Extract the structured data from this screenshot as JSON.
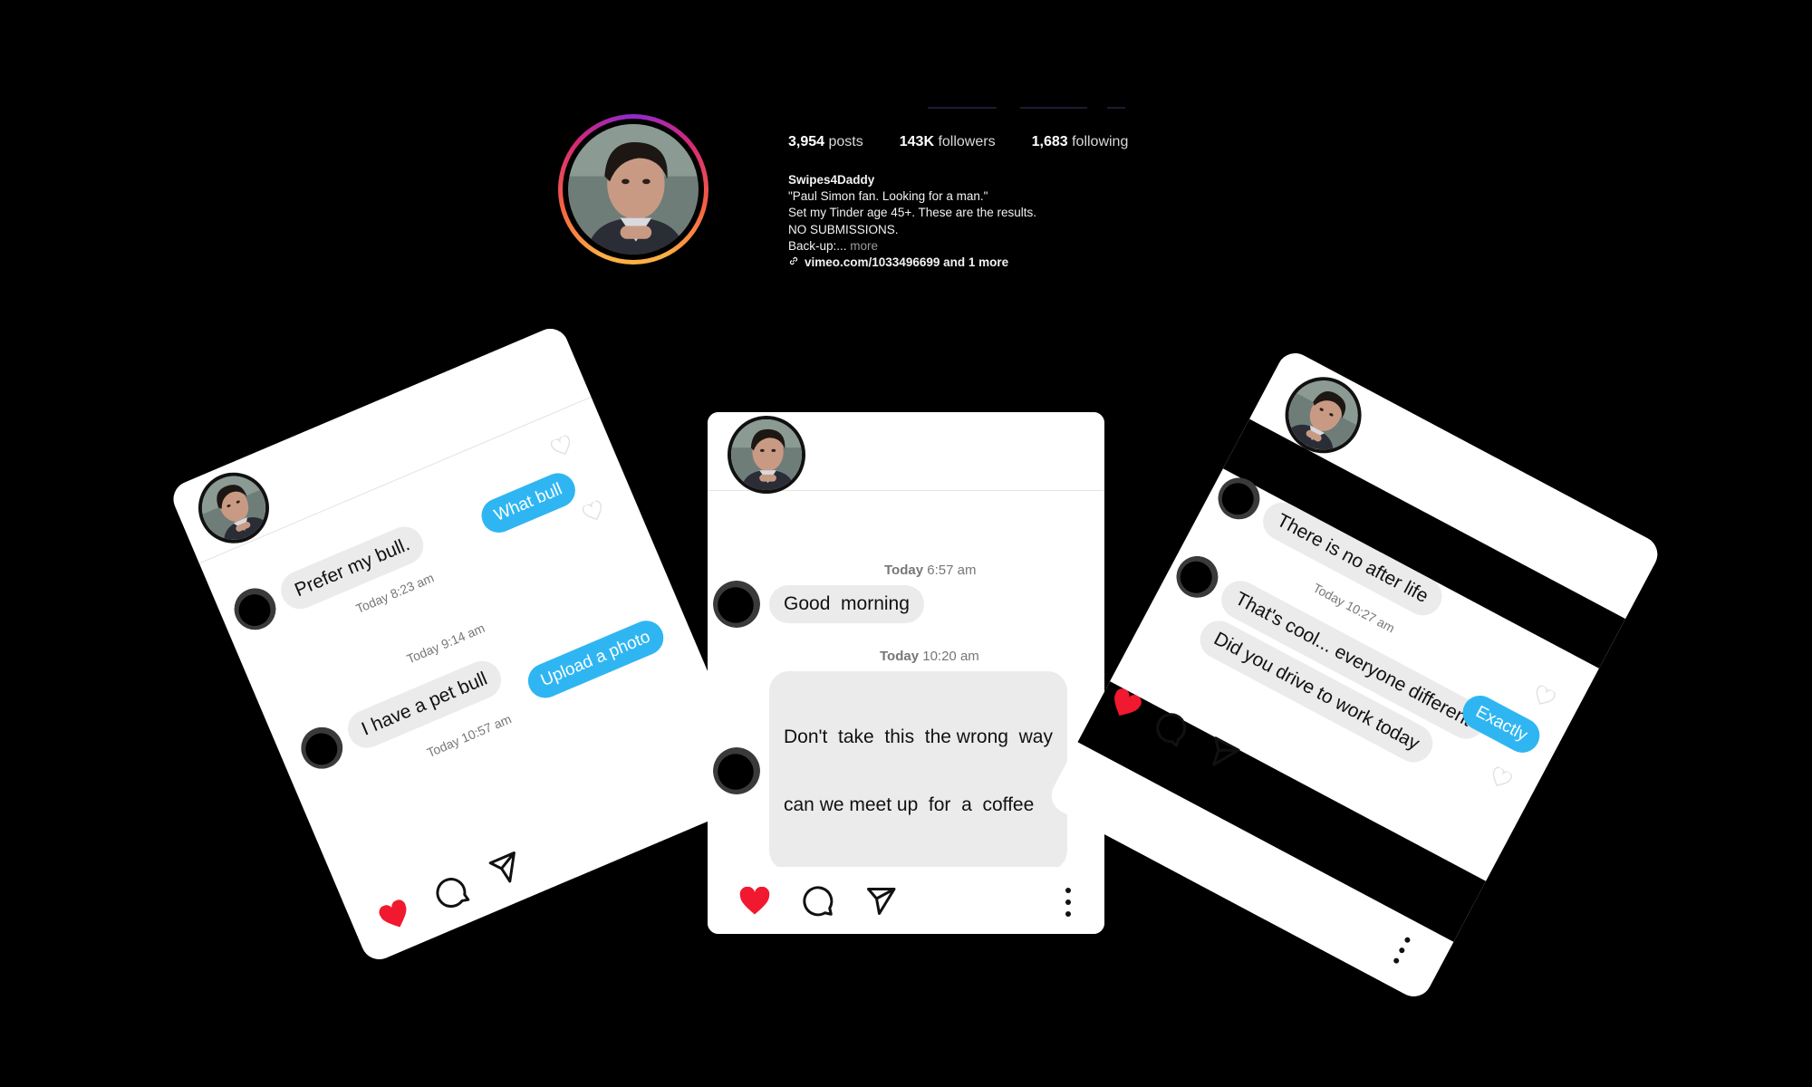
{
  "profile": {
    "posts_count": "3,954",
    "posts_label": "posts",
    "followers_count": "143K",
    "followers_label": "followers",
    "following_count": "1,683",
    "following_label": "following",
    "username": "Swipes4Daddy",
    "bio_lines": [
      "\"Paul Simon fan. Looking for a man.\"",
      "Set my Tinder age 45+. These are the results.",
      "NO SUBMISSIONS."
    ],
    "backup_prefix": "Back-up:...",
    "more_label": "more",
    "link_text": "vimeo.com/1033496699 and 1 more"
  },
  "left_card": {
    "messages": [
      {
        "text": "Prefer my bull.",
        "dir": "in"
      },
      {
        "text": "What bull",
        "dir": "out"
      },
      {
        "text": "I have a pet bull",
        "dir": "in"
      },
      {
        "text": "Upload a photo",
        "dir": "out"
      }
    ],
    "timestamps": [
      "Today 8:23 am",
      "Today 9:14 am",
      "Today 10:57 am"
    ]
  },
  "center_card": {
    "timestamp_1_day": "Today",
    "timestamp_1_time": "6:57 am",
    "message_1": "Good  morning",
    "timestamp_2_day": "Today",
    "timestamp_2_time": "10:20 am",
    "message_2_line1": "Don't  take  this  the wrong  way",
    "message_2_line2": "can we meet up  for  a  coffee"
  },
  "right_card": {
    "messages": [
      {
        "text": "There is no after life",
        "dir": "in"
      },
      {
        "text": "That's cool... everyone different",
        "dir": "in"
      },
      {
        "text": "Exactly",
        "dir": "out"
      },
      {
        "text": "Did you drive to work today",
        "dir": "in"
      }
    ],
    "timestamps": [
      "Today 10:27 am"
    ]
  },
  "icons": {
    "like": "heart-icon",
    "comment": "comment-icon",
    "share": "paper-plane-icon",
    "more": "more-vertical-icon"
  },
  "colors": {
    "like_red": "#f0192f",
    "bubble_blue": "#2fb6f2",
    "bubble_grey": "#ebebeb",
    "background": "#000000"
  }
}
